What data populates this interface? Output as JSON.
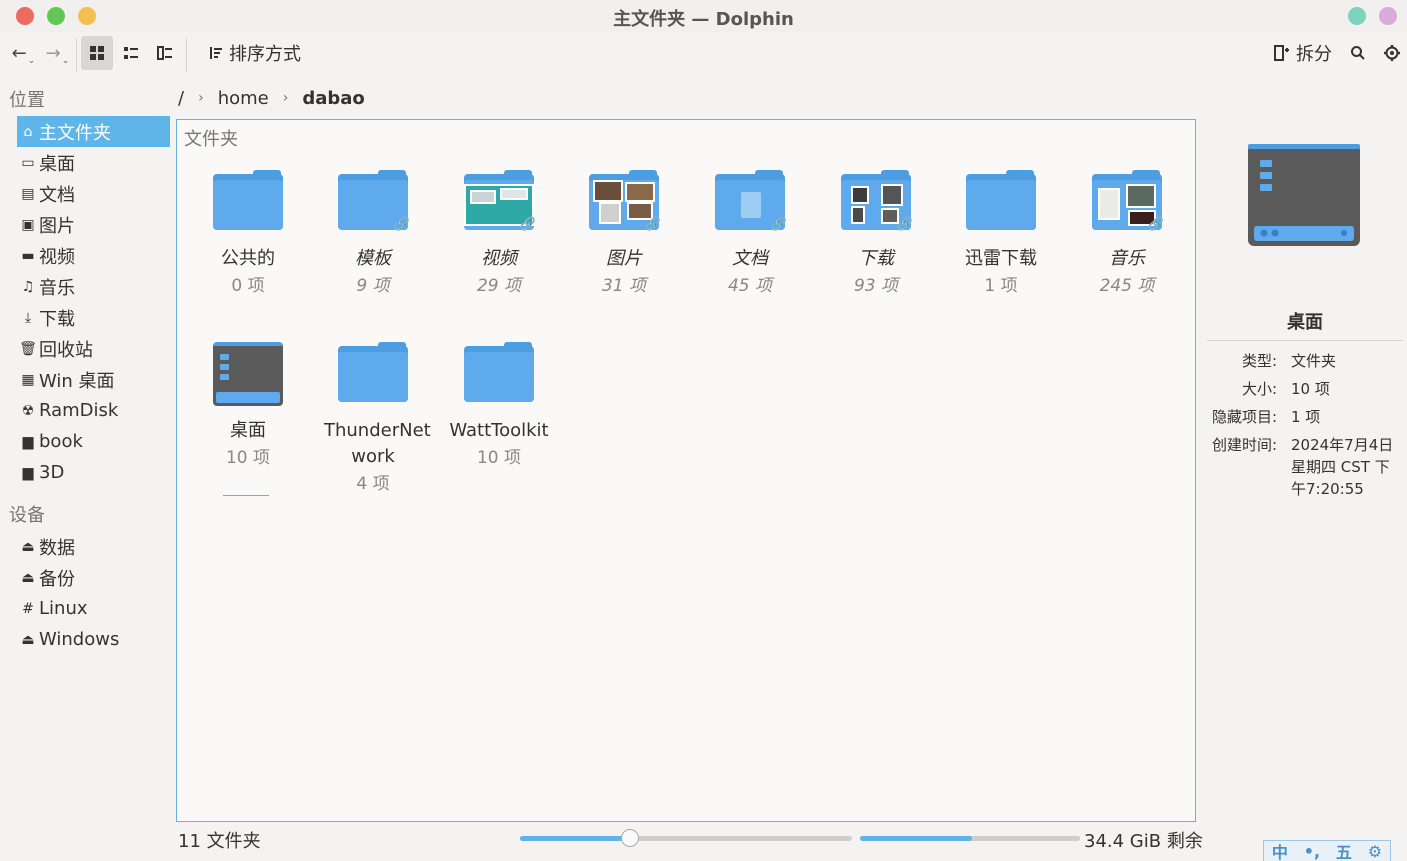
{
  "window": {
    "title": "主文件夹 — Dolphin"
  },
  "toolbar": {
    "back_icon": "←",
    "forward_icon": "→",
    "sort_label": "排序方式",
    "split_label": "拆分"
  },
  "sidebar": {
    "places_title": "位置",
    "devices_title": "设备",
    "places": [
      {
        "label": "主文件夹",
        "icon": "⌂",
        "active": true
      },
      {
        "label": "桌面",
        "icon": "▭"
      },
      {
        "label": "文档",
        "icon": "▤"
      },
      {
        "label": "图片",
        "icon": "▣"
      },
      {
        "label": "视频",
        "icon": "▬"
      },
      {
        "label": "音乐",
        "icon": "♫"
      },
      {
        "label": "下载",
        "icon": "⤓"
      },
      {
        "label": "回收站",
        "icon": "🗑"
      },
      {
        "label": "Win 桌面",
        "icon": "▦"
      },
      {
        "label": "RamDisk",
        "icon": "☢"
      },
      {
        "label": "book",
        "icon": "▆"
      },
      {
        "label": "3D",
        "icon": "▆"
      }
    ],
    "devices": [
      {
        "label": "数据",
        "icon": "⏏"
      },
      {
        "label": "备份",
        "icon": "⏏"
      },
      {
        "label": "Linux",
        "icon": "#"
      },
      {
        "label": "Windows",
        "icon": "⏏"
      }
    ]
  },
  "breadcrumb": {
    "root": "/",
    "segments": [
      "home",
      "dabao"
    ]
  },
  "main": {
    "group_title": "文件夹",
    "items": [
      {
        "name": "公共的",
        "count": "0 项",
        "italic": false
      },
      {
        "name": "模板",
        "count": "9 项",
        "italic": true
      },
      {
        "name": "视频",
        "count": "29 项",
        "italic": true
      },
      {
        "name": "图片",
        "count": "31 项",
        "italic": true
      },
      {
        "name": "文档",
        "count": "45 项",
        "italic": true
      },
      {
        "name": "下载",
        "count": "93 项",
        "italic": true
      },
      {
        "name": "迅雷下载",
        "count": "1 项",
        "italic": false
      },
      {
        "name": "音乐",
        "count": "245 项",
        "italic": true
      },
      {
        "name": "桌面",
        "count": "10 项",
        "italic": false
      },
      {
        "name": "ThunderNet work",
        "count": "4 项",
        "italic": false
      },
      {
        "name": "WattToolkit",
        "count": "10 项",
        "italic": false
      }
    ]
  },
  "info": {
    "title": "桌面",
    "type_key": "类型:",
    "type_val": "文件夹",
    "size_key": "大小:",
    "size_val": "10 项",
    "hidden_key": "隐藏项目:",
    "hidden_val": "1 项",
    "created_key": "创建时间:",
    "created_val": "2024年7月4日 星期四 CST 下午7:20:55"
  },
  "status": {
    "summary": "11 文件夹",
    "free_space": "34.4 GiB 剩余",
    "zoom_level": 0.33,
    "disk_used_fraction": 0.51
  },
  "ime": {
    "lang": "中",
    "punct": "•,",
    "mode": "五",
    "gear": "⚙"
  },
  "colors": {
    "accent": "#5fb5e8",
    "folder": "#5faaec"
  }
}
